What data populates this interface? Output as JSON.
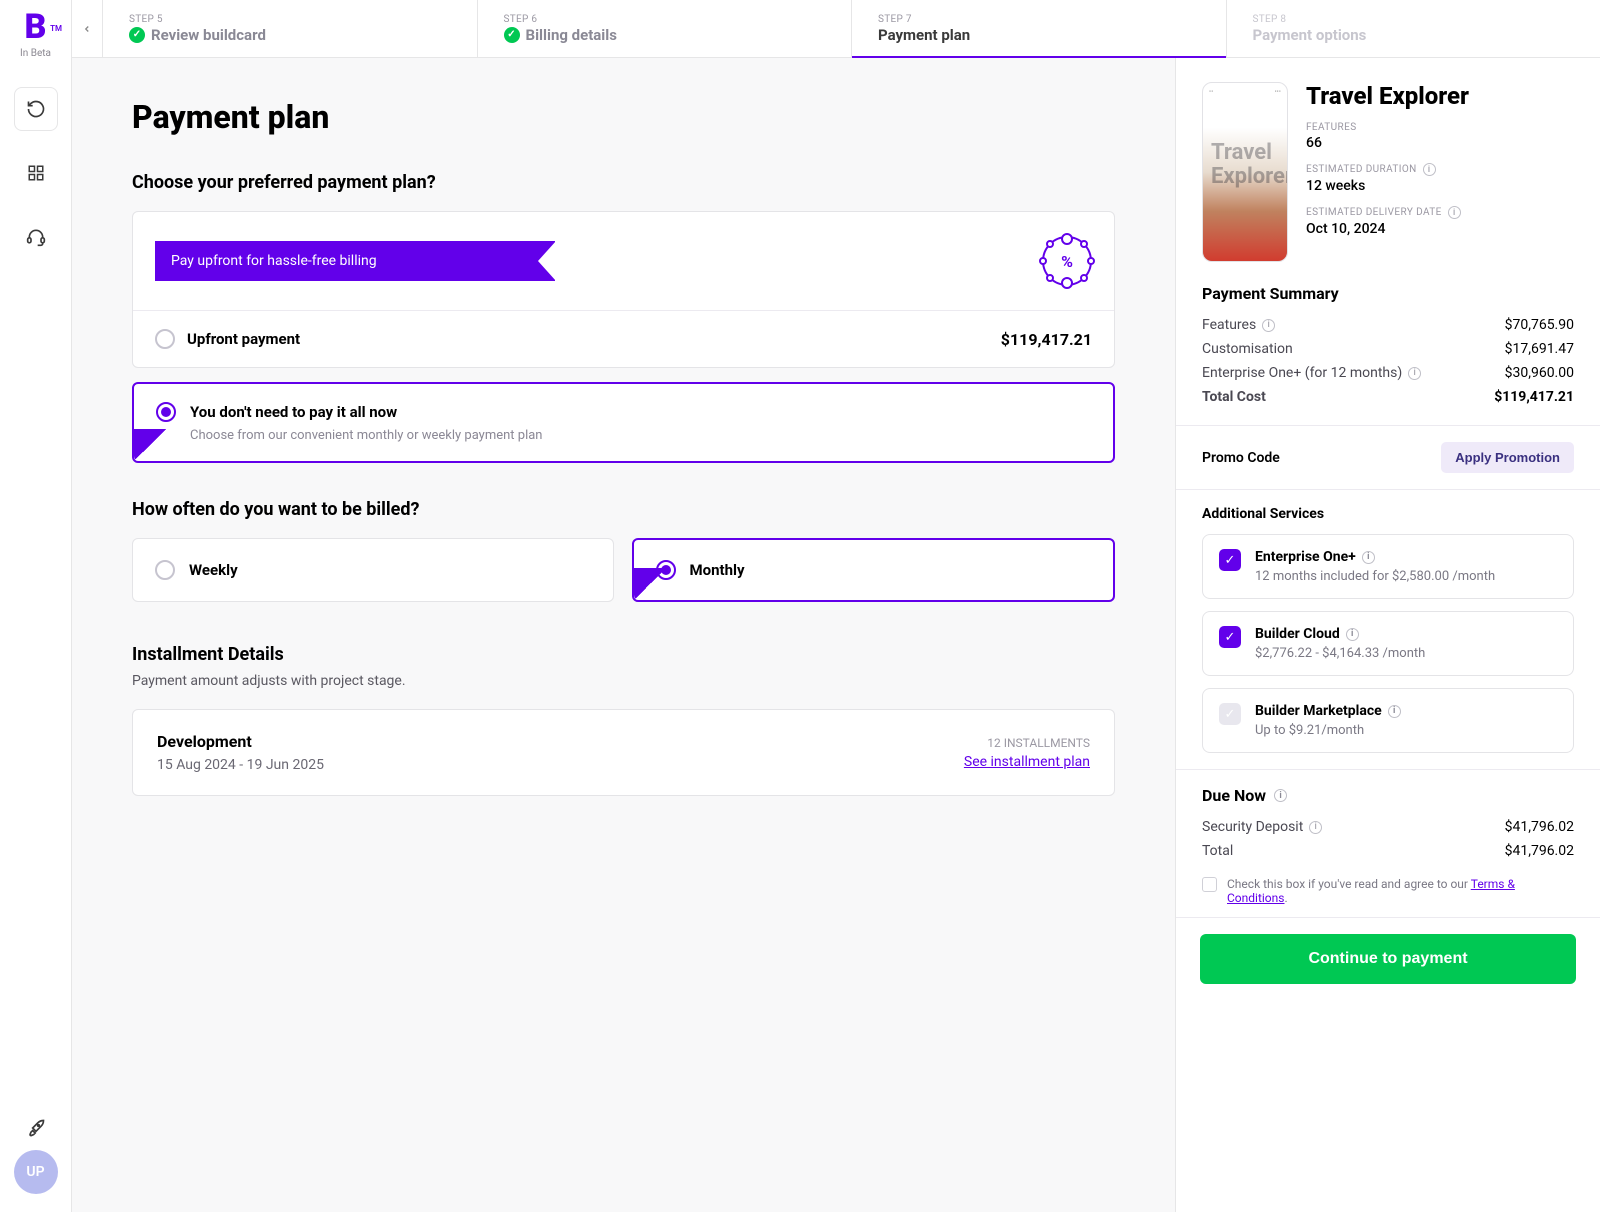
{
  "brand": {
    "initials": "B",
    "tm": "TM",
    "beta": "In Beta",
    "avatar": "UP"
  },
  "steps": {
    "back": "‹",
    "s5": {
      "label": "STEP 5",
      "title": "Review buildcard"
    },
    "s6": {
      "label": "STEP 6",
      "title": "Billing details"
    },
    "s7": {
      "label": "STEP 7",
      "title": "Payment plan"
    },
    "s8": {
      "label": "STEP 8",
      "title": "Payment options"
    }
  },
  "page": {
    "title": "Payment plan",
    "choose_heading": "Choose your preferred payment plan?",
    "upfront_banner": "Pay upfront for hassle-free billing",
    "discount_icon": "%",
    "upfront_label": "Upfront payment",
    "upfront_price": "$119,417.21",
    "installment_title": "You don't need to pay it all now",
    "installment_sub": "Choose from our convenient monthly or weekly payment plan",
    "freq_heading": "How often do you want to be billed?",
    "weekly": "Weekly",
    "monthly": "Monthly",
    "inst_heading": "Installment Details",
    "inst_subtext": "Payment amount adjusts with project stage.",
    "inst_phase": "Development",
    "inst_dates": "15 Aug 2024 - 19 Jun 2025",
    "inst_count": "12 INSTALLMENTS",
    "inst_link": "See installment plan"
  },
  "summary": {
    "project_name": "Travel Explorer",
    "thumb_title": "Travel Explorer",
    "features_label": "FEATURES",
    "features_val": "66",
    "duration_label": "ESTIMATED DURATION",
    "duration_val": "12 weeks",
    "delivery_label": "ESTIMATED DELIVERY DATE",
    "delivery_val": "Oct 10, 2024",
    "payment_header": "Payment Summary",
    "r_features_k": "Features",
    "r_features_v": "$70,765.90",
    "r_custom_k": "Customisation",
    "r_custom_v": "$17,691.47",
    "r_ent_k": "Enterprise One+ (for 12 months)",
    "r_ent_v": "$30,960.00",
    "r_total_k": "Total Cost",
    "r_total_v": "$119,417.21",
    "promo_label": "Promo Code",
    "promo_btn": "Apply Promotion",
    "addl_header": "Additional Services",
    "svc1_name": "Enterprise One+",
    "svc1_sub": "12 months included for $2,580.00 /month",
    "svc2_name": "Builder Cloud",
    "svc2_sub": "$2,776.22 - $4,164.33 /month",
    "svc3_name": "Builder Marketplace",
    "svc3_sub": "Up to $9.21/month",
    "due_header": "Due Now",
    "due_dep_k": "Security Deposit",
    "due_dep_v": "$41,796.02",
    "due_total_k": "Total",
    "due_total_v": "$41,796.02",
    "terms_pre": "Check this box if you've read and agree to our ",
    "terms_link": "Terms & Conditions",
    "terms_post": ".",
    "cta": "Continue to payment"
  },
  "glyph": {
    "check": "✓",
    "info": "i"
  }
}
